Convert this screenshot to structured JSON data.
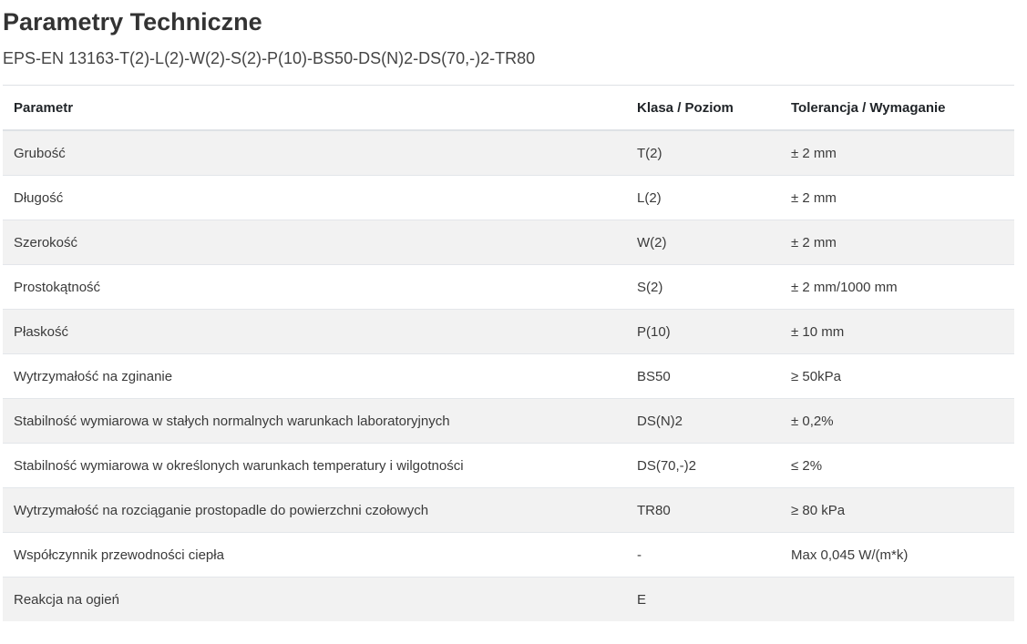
{
  "title": "Parametry Techniczne",
  "subtitle": "EPS-EN 13163-T(2)-L(2)-W(2)-S(2)-P(10)-BS50-DS(N)2-DS(70,-)2-TR80",
  "table": {
    "headers": [
      "Parametr",
      "Klasa / Poziom",
      "Tolerancja / Wymaganie"
    ],
    "rows": [
      [
        "Grubość",
        "T(2)",
        "± 2 mm"
      ],
      [
        "Długość",
        "L(2)",
        "± 2 mm"
      ],
      [
        "Szerokość",
        "W(2)",
        "± 2 mm"
      ],
      [
        "Prostokątność",
        "S(2)",
        "± 2 mm/1000 mm"
      ],
      [
        "Płaskość",
        "P(10)",
        "± 10 mm"
      ],
      [
        "Wytrzymałość na zginanie",
        "BS50",
        "≥ 50kPa"
      ],
      [
        "Stabilność wymiarowa w stałych normalnych warunkach laboratoryjnych",
        "DS(N)2",
        "± 0,2%"
      ],
      [
        "Stabilność wymiarowa w określonych warunkach temperatury i wilgotności",
        "DS(70,-)2",
        "≤ 2%"
      ],
      [
        "Wytrzymałość na rozciąganie prostopadle do powierzchni czołowych",
        "TR80",
        "≥ 80 kPa"
      ],
      [
        "Współczynnik przewodności ciepła",
        "-",
        "Max 0,045 W/(m*k)"
      ],
      [
        "Reakcja na ogień",
        "E",
        ""
      ]
    ]
  }
}
